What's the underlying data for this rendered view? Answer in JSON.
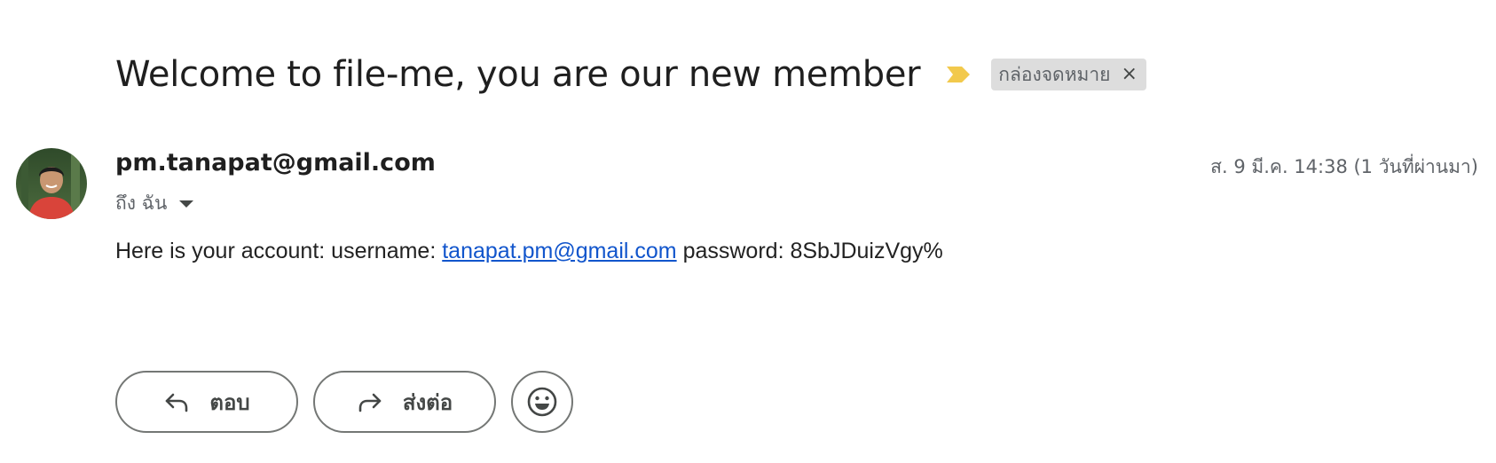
{
  "email": {
    "subject": "Welcome to file-me, you are our new member",
    "label": "กล่องจดหมาย",
    "label_remove": "×",
    "sender": "pm.tanapat@gmail.com",
    "date": "ส. 9 มี.ค. 14:38 (1 วันที่ผ่านมา)",
    "recipient": "ถึง ฉัน",
    "body": {
      "prefix": "Here is your account: username: ",
      "link": "tanapat.pm@gmail.com",
      "suffix": "  password: 8SbJDuizVgy%"
    }
  },
  "actions": {
    "reply_label": "ตอบ",
    "forward_label": "ส่งต่อ"
  },
  "icons": {
    "importance": "important-marker-icon",
    "reply": "reply-icon",
    "forward": "forward-icon",
    "emoji": "emoji-reaction-icon",
    "recipient_dropdown": "chevron-down-icon"
  },
  "colors": {
    "importance_marker": "#f2c94c",
    "link": "#1155cc",
    "label_bg": "#dddddd",
    "button_border": "#747775"
  }
}
